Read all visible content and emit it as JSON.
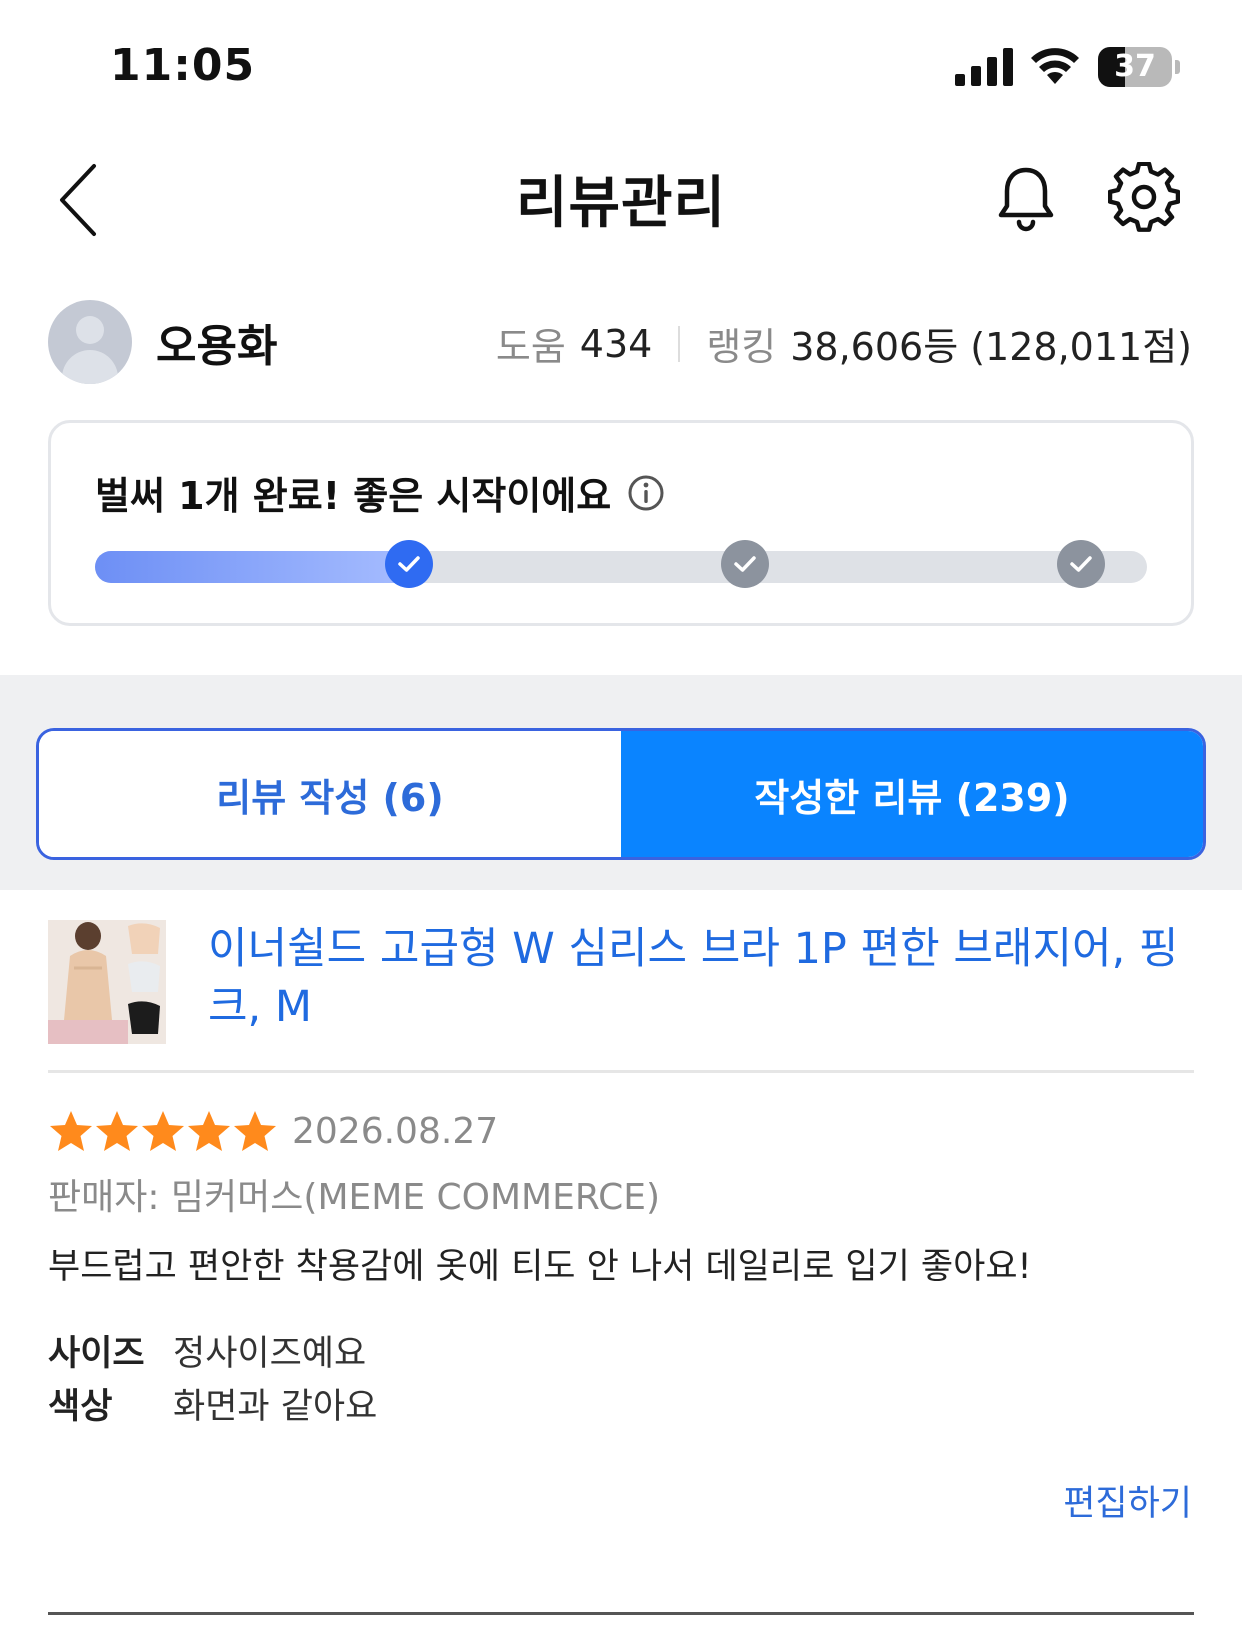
{
  "status_bar": {
    "time": "11:05",
    "battery_level": "37",
    "battery_fraction": 0.37,
    "signal_icon": "cellular-signal-icon",
    "wifi_icon": "wifi-icon",
    "battery_icon": "battery-icon"
  },
  "nav": {
    "title": "리뷰관리",
    "back_icon": "chevron-left-icon",
    "notification_icon": "bell-icon",
    "settings_icon": "gear-icon"
  },
  "profile": {
    "name": "오용화",
    "help_label": "도움",
    "help_count": "434",
    "ranking_label": "랭킹",
    "ranking_value": "38,606등 (128,011점)"
  },
  "progress": {
    "message": "벌써 1개 완료! 좋은 시작이에요",
    "info_icon": "info-icon",
    "completed_steps": 1,
    "total_steps": 3,
    "fill_fraction": 0.31
  },
  "tabs": [
    {
      "label": "리뷰 작성 (6)",
      "active": false
    },
    {
      "label": "작성한 리뷰 (239)",
      "active": true
    }
  ],
  "review": {
    "product_name": "이너쉴드 고급형 W 심리스 브라 1P 편한 브래지어, 핑크, M",
    "rating": 5,
    "max_rating": 5,
    "date": "2026.08.27",
    "seller": "판매자: 밈커머스(MEME COMMERCE)",
    "text": "부드럽고 편안한 착용감에 옷에 티도 안 나서 데일리로 입기 좋아요!",
    "attributes": [
      {
        "label": "사이즈",
        "value": "정사이즈예요"
      },
      {
        "label": "색상",
        "value": "화면과 같아요"
      }
    ],
    "edit_label": "편집하기"
  },
  "colors": {
    "accent": "#0a84ff",
    "link": "#2d6bd9",
    "star": "#ff8a1c",
    "step_active": "#2f6bf2",
    "step_inactive": "#8c939e"
  }
}
